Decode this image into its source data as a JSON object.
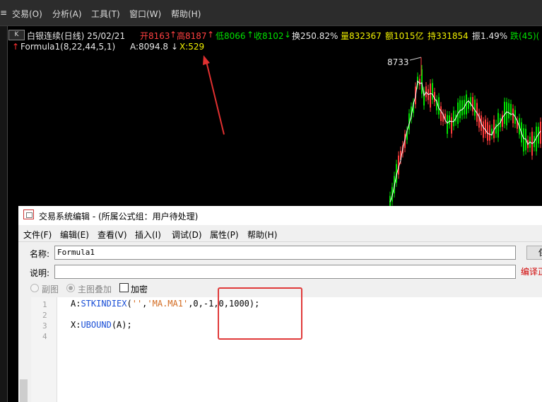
{
  "menubar": {
    "items": [
      "交易(O)",
      "分析(A)",
      "工具(T)",
      "窗口(W)",
      "帮助(H)"
    ],
    "partial_left": "≡"
  },
  "chart": {
    "header": {
      "k_icon": "K",
      "title": "白银连续(日线) 25/02/21",
      "open": "开8163",
      "high": "高8187",
      "low": "低8066",
      "close": "收8102",
      "turnover": "换250.82%",
      "volume": "量832367",
      "amount": "额1015亿",
      "hold": "持331854",
      "amplitude": "振1.49%",
      "drop": "跌(45)("
    },
    "formula_line": {
      "name": "Formula1(8,22,44,5,1)",
      "a_value": "A:8094.8",
      "x_value": "X:529"
    },
    "peak_label": "8733",
    "colors": {
      "up": "#ff3b3b",
      "down": "#00e000",
      "ma": "#ffffff",
      "header_white": "#e8e8e8",
      "yellow": "#f0f000"
    }
  },
  "dialog": {
    "title": "交易系统编辑 - (所属公式组：用户待处理)",
    "menu": [
      "文件(F)",
      "编辑(E)",
      "查看(V)",
      "插入(I)",
      "调试(D)",
      "属性(P)",
      "帮助(H)"
    ],
    "name_label": "名称:",
    "name_value": "Formula1",
    "desc_label": "说明:",
    "desc_value": "",
    "right_button": "保",
    "right_link": "编译正",
    "radio_sub": "副图",
    "radio_main": "主图叠加",
    "checkbox_encrypt": "加密",
    "code": {
      "line_numbers": [
        "1",
        "2",
        "3",
        "4"
      ],
      "line1_prefix": "A:",
      "line1_func": "STKINDIEX",
      "line1_open": "(",
      "line1_arg1": "''",
      "line1_comma1": ",",
      "line1_arg2": "'MA.MA1'",
      "line1_rest": ",0,-1,0,1000);",
      "line3_prefix": "X:",
      "line3_func": "UBOUND",
      "line3_rest": "(A);"
    }
  }
}
